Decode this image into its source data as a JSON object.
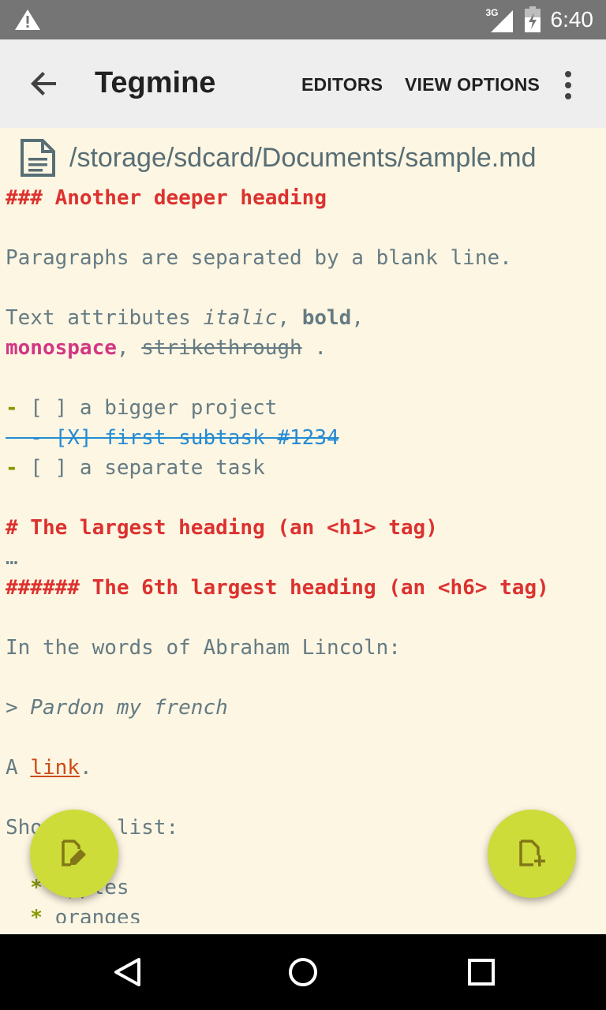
{
  "status_bar": {
    "time": "6:40",
    "network": "3G"
  },
  "app_bar": {
    "title": "Tegmine",
    "actions": [
      "EDITORS",
      "VIEW OPTIONS"
    ]
  },
  "file": {
    "path": "/storage/sdcard/Documents/sample.md"
  },
  "editor": {
    "heading3": "### Another deeper heading",
    "para1": "Paragraphs are separated by a blank line.",
    "attrs_prefix": "Text attributes ",
    "italic": "italic",
    "comma1": ", ",
    "bold": "bold",
    "comma2": ",",
    "monospace": "monospace",
    "comma3": ", ",
    "strikethrough": "strikethrough",
    "end_dot": " .",
    "task1_bullet": "-",
    "task1_text": " [ ] a bigger project",
    "subtask_text": "  - [X] first subtask #1234",
    "task2_bullet": "-",
    "task2_text": " [ ] a separate task",
    "h1": "# The largest heading (an <h1> tag)",
    "ellipsis": "…",
    "h6": "###### The 6th largest heading (an <h6> tag)",
    "lincoln": "In the words of Abraham Lincoln:",
    "quote": "> Pardon my french",
    "link_prefix": "A ",
    "link_text": "link",
    "link_suffix": ".",
    "list_intro": "Shopping list:",
    "item1_bullet": "  *",
    "item1_text": " apples",
    "item2_bullet": "  *",
    "item2_text": " oranges"
  },
  "colors": {
    "background": "#fdf6e3",
    "heading": "#dc322f",
    "monospace": "#d33682",
    "bullet": "#859900",
    "done_task": "#268bd2",
    "link": "#cb4b16",
    "fab": "#cddc39"
  },
  "icons": {
    "fab_left": "edit-document-icon",
    "fab_right": "new-document-icon",
    "file": "file-icon"
  }
}
